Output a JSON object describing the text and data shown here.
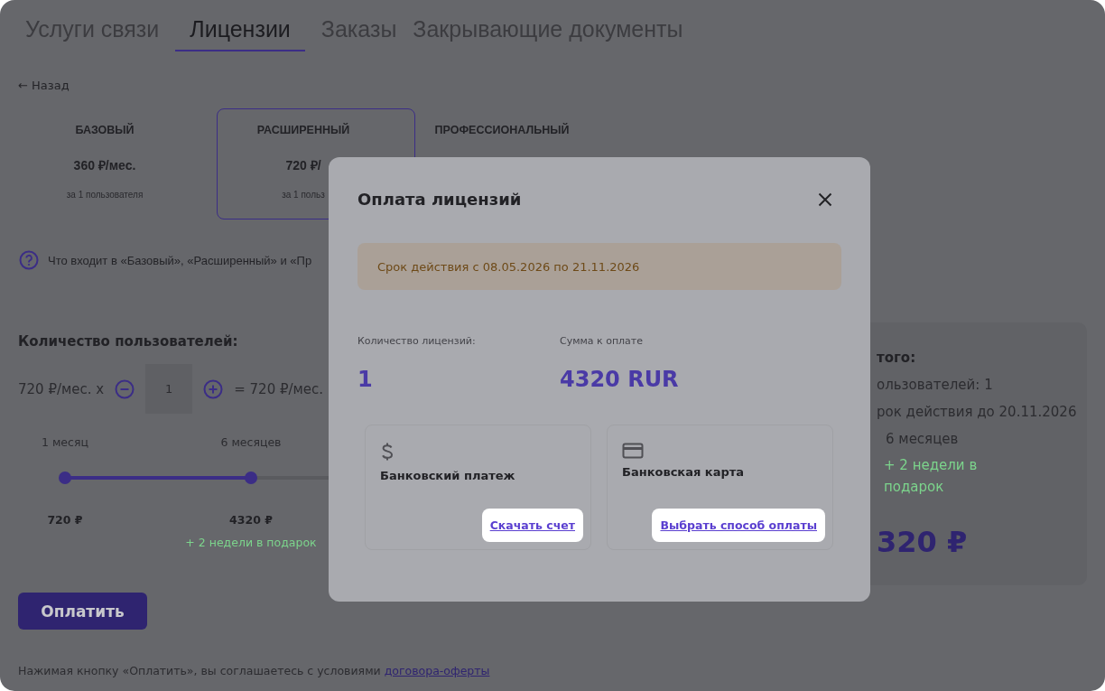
{
  "tabs": [
    {
      "label": "Услуги связи",
      "selected": false
    },
    {
      "label": "Лицензии",
      "selected": true
    },
    {
      "label": "Заказы",
      "selected": false
    },
    {
      "label": "Закрывающие документы",
      "selected": false
    }
  ],
  "back_link": "← Назад",
  "plans": [
    {
      "name": "БАЗОВЫЙ",
      "price": "360 ₽/мес.",
      "per_user": "за 1 пользователя",
      "selected": false
    },
    {
      "name": "РАСШИРЕННЫЙ",
      "price": "720 ₽/",
      "per_user": "за 1 польз",
      "selected": true
    },
    {
      "name": "ПРОФЕССИОНАЛЬНЫЙ",
      "selected": false
    }
  ],
  "help_text": "Что входит в «Базовый», «Расширенный» и «Пр",
  "users": {
    "heading": "Количество пользователей:",
    "price_prefix": "720 ₽/мес. x",
    "count": "1",
    "result": "= 720 ₽/мес."
  },
  "period": {
    "level": 0.5,
    "stops": [
      {
        "label": "1 месяц",
        "price": "720 ₽"
      },
      {
        "label": "6 месяцев",
        "price": "4320 ₽",
        "bonus": "+ 2 недели в подарок"
      }
    ]
  },
  "pay_button": "Оплатить",
  "agreement": {
    "text": "Нажимая кнопку «Оплатить», вы соглашаетесь с условиями",
    "link": "договора-оферты"
  },
  "summary": {
    "heading": "того:",
    "users": "ользователей: 1",
    "valid_until": "рок действия до 20.11.2026",
    "period": "6 месяцев",
    "bonus": "+ 2 недели в подарок",
    "total": "320 ₽"
  },
  "modal": {
    "title": "Оплата лицензий",
    "notice": "Срок действия с 08.05.2026 по 21.11.2026",
    "stats": [
      {
        "label": "Количество лицензий:",
        "value": "1"
      },
      {
        "label": "Сумма к оплате",
        "value": "4320 RUR"
      }
    ],
    "methods": [
      {
        "kind": "invoice",
        "title": "Банковский платеж",
        "action": "Скачать счет"
      },
      {
        "kind": "card",
        "title": "Банковская карта",
        "action": "Выбрать способ оплаты"
      }
    ]
  }
}
